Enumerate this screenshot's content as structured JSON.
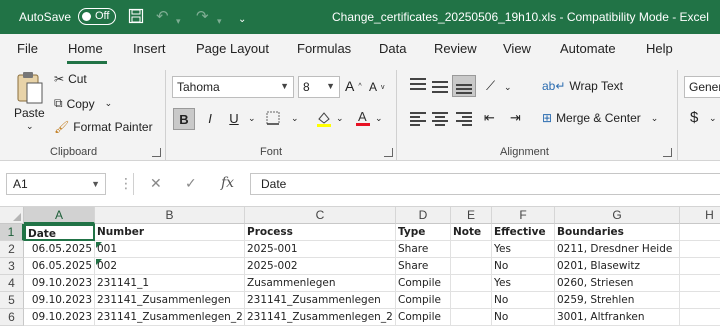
{
  "titlebar": {
    "autosave_label": "AutoSave",
    "autosave_state": "Off",
    "title": "Change_certificates_20250506_19h10.xls  -  Compatibility Mode  -  Excel"
  },
  "tabs": [
    "File",
    "Home",
    "Insert",
    "Page Layout",
    "Formulas",
    "Data",
    "Review",
    "View",
    "Automate",
    "Help"
  ],
  "ribbon": {
    "clipboard": {
      "paste": "Paste",
      "cut": "Cut",
      "copy": "Copy",
      "format_painter": "Format Painter",
      "label": "Clipboard"
    },
    "font": {
      "name": "Tahoma",
      "size": "8",
      "label": "Font",
      "bold": "B",
      "italic": "I",
      "underline": "U"
    },
    "alignment": {
      "wrap_text": "Wrap Text",
      "merge_center": "Merge & Center",
      "label": "Alignment"
    },
    "number": {
      "format": "Gener"
    }
  },
  "formula_bar": {
    "name_box": "A1",
    "content": "Date"
  },
  "columns": [
    "A",
    "B",
    "C",
    "D",
    "E",
    "F",
    "G",
    "H"
  ],
  "rows": [
    [
      "Date",
      "Number",
      "Process",
      "Type",
      "Note",
      "Effective",
      "Boundaries"
    ],
    [
      "06.05.2025",
      "001",
      "2025-001",
      "Share",
      "",
      "Yes",
      "0211, Dresdner Heide"
    ],
    [
      "06.05.2025",
      "002",
      "2025-002",
      "Share",
      "",
      "No",
      "0201, Blasewitz"
    ],
    [
      "09.10.2023",
      "231141_1",
      "Zusammenlegen",
      "Compile",
      "",
      "Yes",
      "0260, Striesen"
    ],
    [
      "09.10.2023",
      "231141_Zusammenlegen",
      "231141_Zusammenlegen",
      "Compile",
      "",
      "No",
      "0259, Strehlen"
    ],
    [
      "09.10.2023",
      "231141_Zusammenlegen_2",
      "231141_Zusammenlegen_2",
      "Compile",
      "",
      "No",
      "3001, Altfranken"
    ]
  ],
  "row_numbers": [
    "1",
    "2",
    "3",
    "4",
    "5",
    "6"
  ],
  "colors": {
    "accent": "#217346"
  }
}
